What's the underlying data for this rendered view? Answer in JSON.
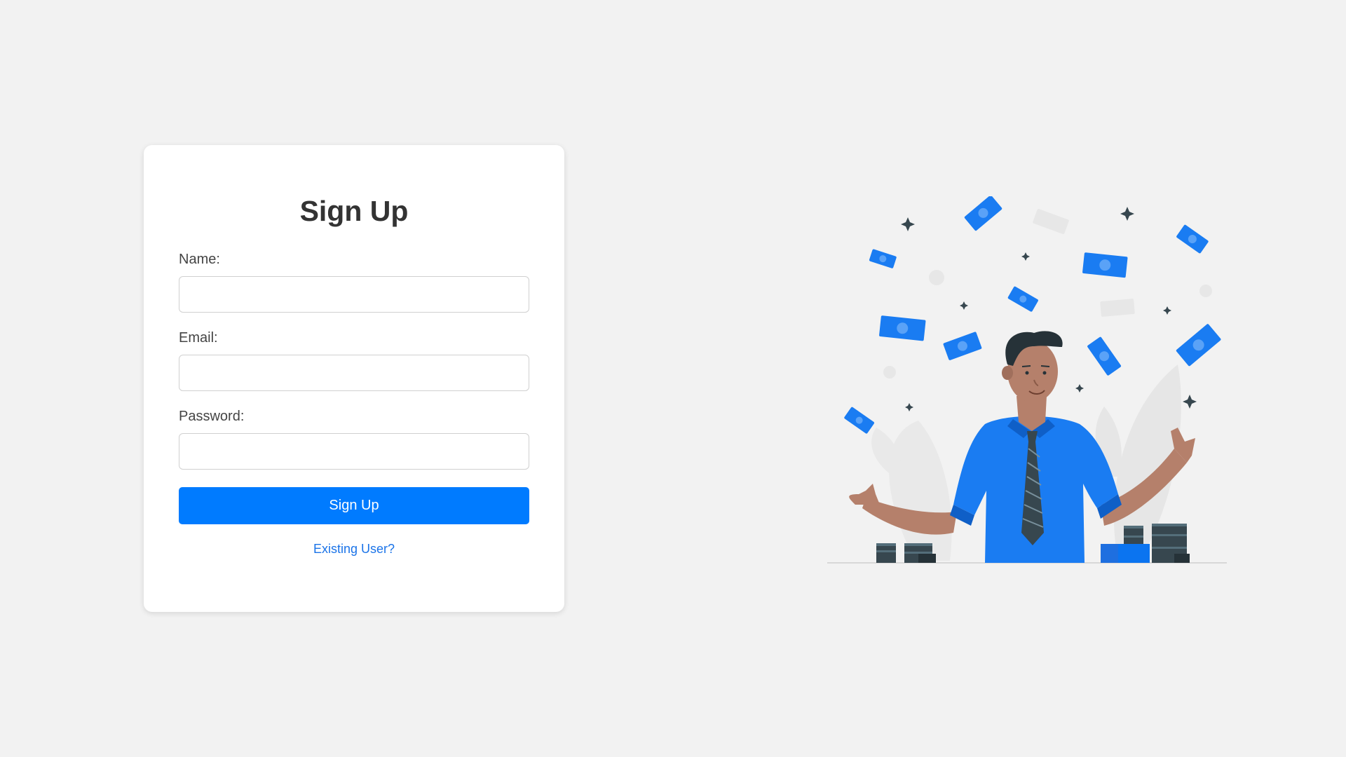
{
  "form": {
    "title": "Sign Up",
    "name_label": "Name:",
    "email_label": "Email:",
    "password_label": "Password:",
    "name_value": "",
    "email_value": "",
    "password_value": "",
    "submit_label": "Sign Up",
    "existing_user_link": "Existing User?"
  },
  "colors": {
    "background": "#f2f2f2",
    "card": "#ffffff",
    "primary": "#007bff",
    "link": "#1a73e8",
    "title_text": "#333333"
  },
  "illustration": {
    "icon": "man-with-money-illustration"
  }
}
